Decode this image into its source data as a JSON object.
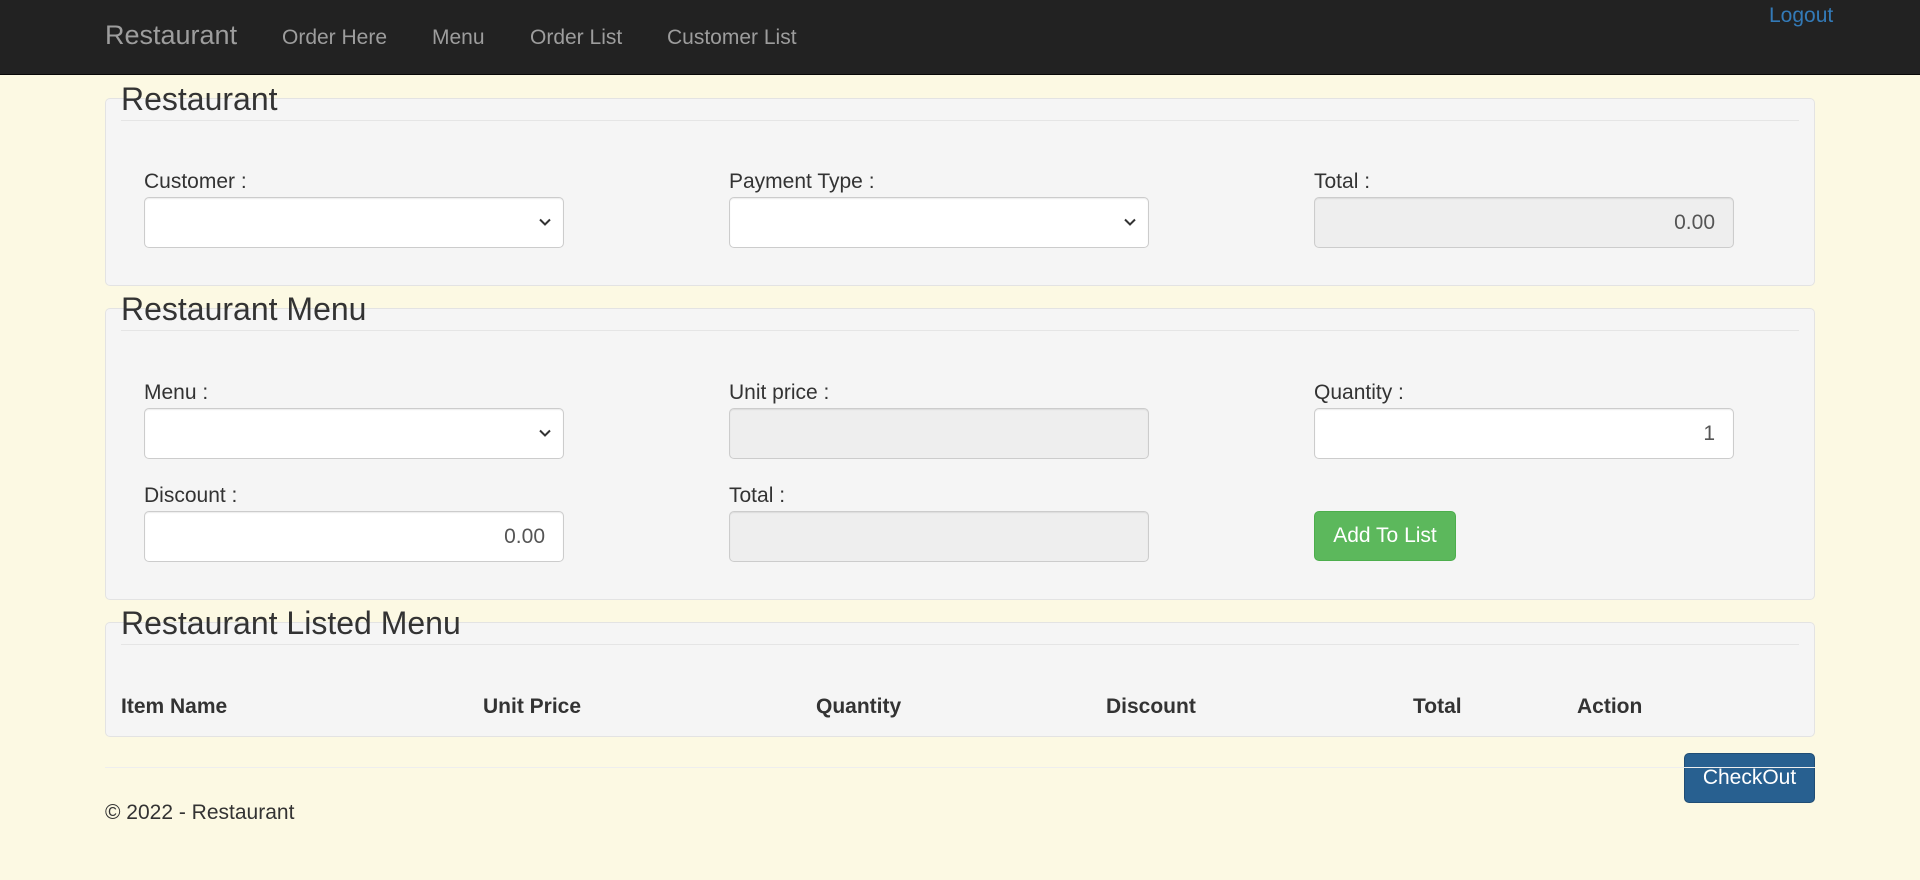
{
  "navbar": {
    "brand": "Restaurant",
    "links": [
      "Order Here",
      "Menu",
      "Order List",
      "Customer List"
    ],
    "logout": "Logout"
  },
  "order_panel": {
    "title": "Restaurant",
    "customer_label": "Customer :",
    "customer_value": "",
    "payment_label": "Payment Type :",
    "payment_value": "",
    "total_label": "Total :",
    "total_value": "0.00"
  },
  "menu_panel": {
    "title": "Restaurant Menu",
    "menu_label": "Menu :",
    "menu_value": "",
    "unit_price_label": "Unit price :",
    "unit_price_value": "",
    "quantity_label": "Quantity :",
    "quantity_value": "1",
    "discount_label": "Discount :",
    "discount_value": "0.00",
    "total_label": "Total :",
    "total_value": "",
    "add_button": "Add To List"
  },
  "listed_panel": {
    "title": "Restaurant Listed Menu",
    "columns": [
      "Item Name",
      "Unit Price",
      "Quantity",
      "Discount",
      "Total",
      "Action"
    ]
  },
  "checkout_button": "CheckOut",
  "footer": "© 2022 - Restaurant",
  "colors": {
    "page_bg": "#fcf9e3",
    "navbar_bg": "#222222",
    "link": "#337ab7",
    "success": "#5cb85c",
    "primary": "#286090"
  }
}
